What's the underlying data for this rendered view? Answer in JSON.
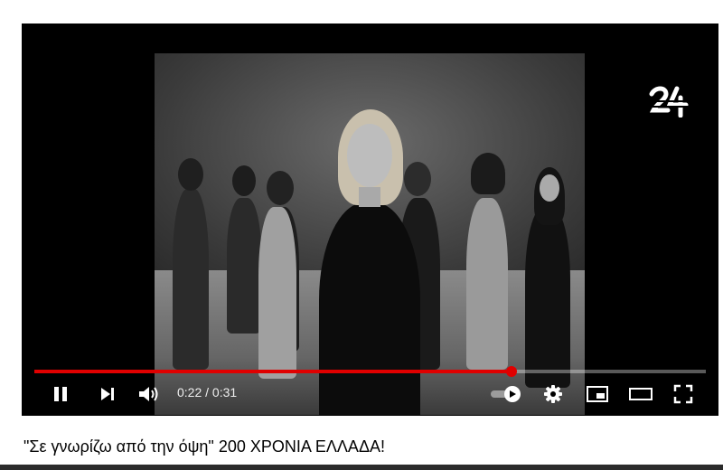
{
  "player": {
    "current_time": "0:22",
    "separator": " / ",
    "duration": "0:31",
    "progress_fraction": 0.71
  },
  "video": {
    "title": "\"Σε γνωρίζω από την όψη\" 200 ΧΡΟΝΙΑ ΕΛΛΑΔΑ!"
  },
  "icons": {
    "pause": "pause-icon",
    "next": "next-icon",
    "volume": "volume-icon",
    "autoplay": "autoplay-toggle-icon",
    "settings": "gear-icon",
    "miniplayer": "miniplayer-icon",
    "theater": "theater-mode-icon",
    "fullscreen": "fullscreen-icon",
    "channel_logo": "channel-24-logo"
  },
  "colors": {
    "progress": "#e00000",
    "player_bg": "#000000",
    "title": "#030303"
  }
}
